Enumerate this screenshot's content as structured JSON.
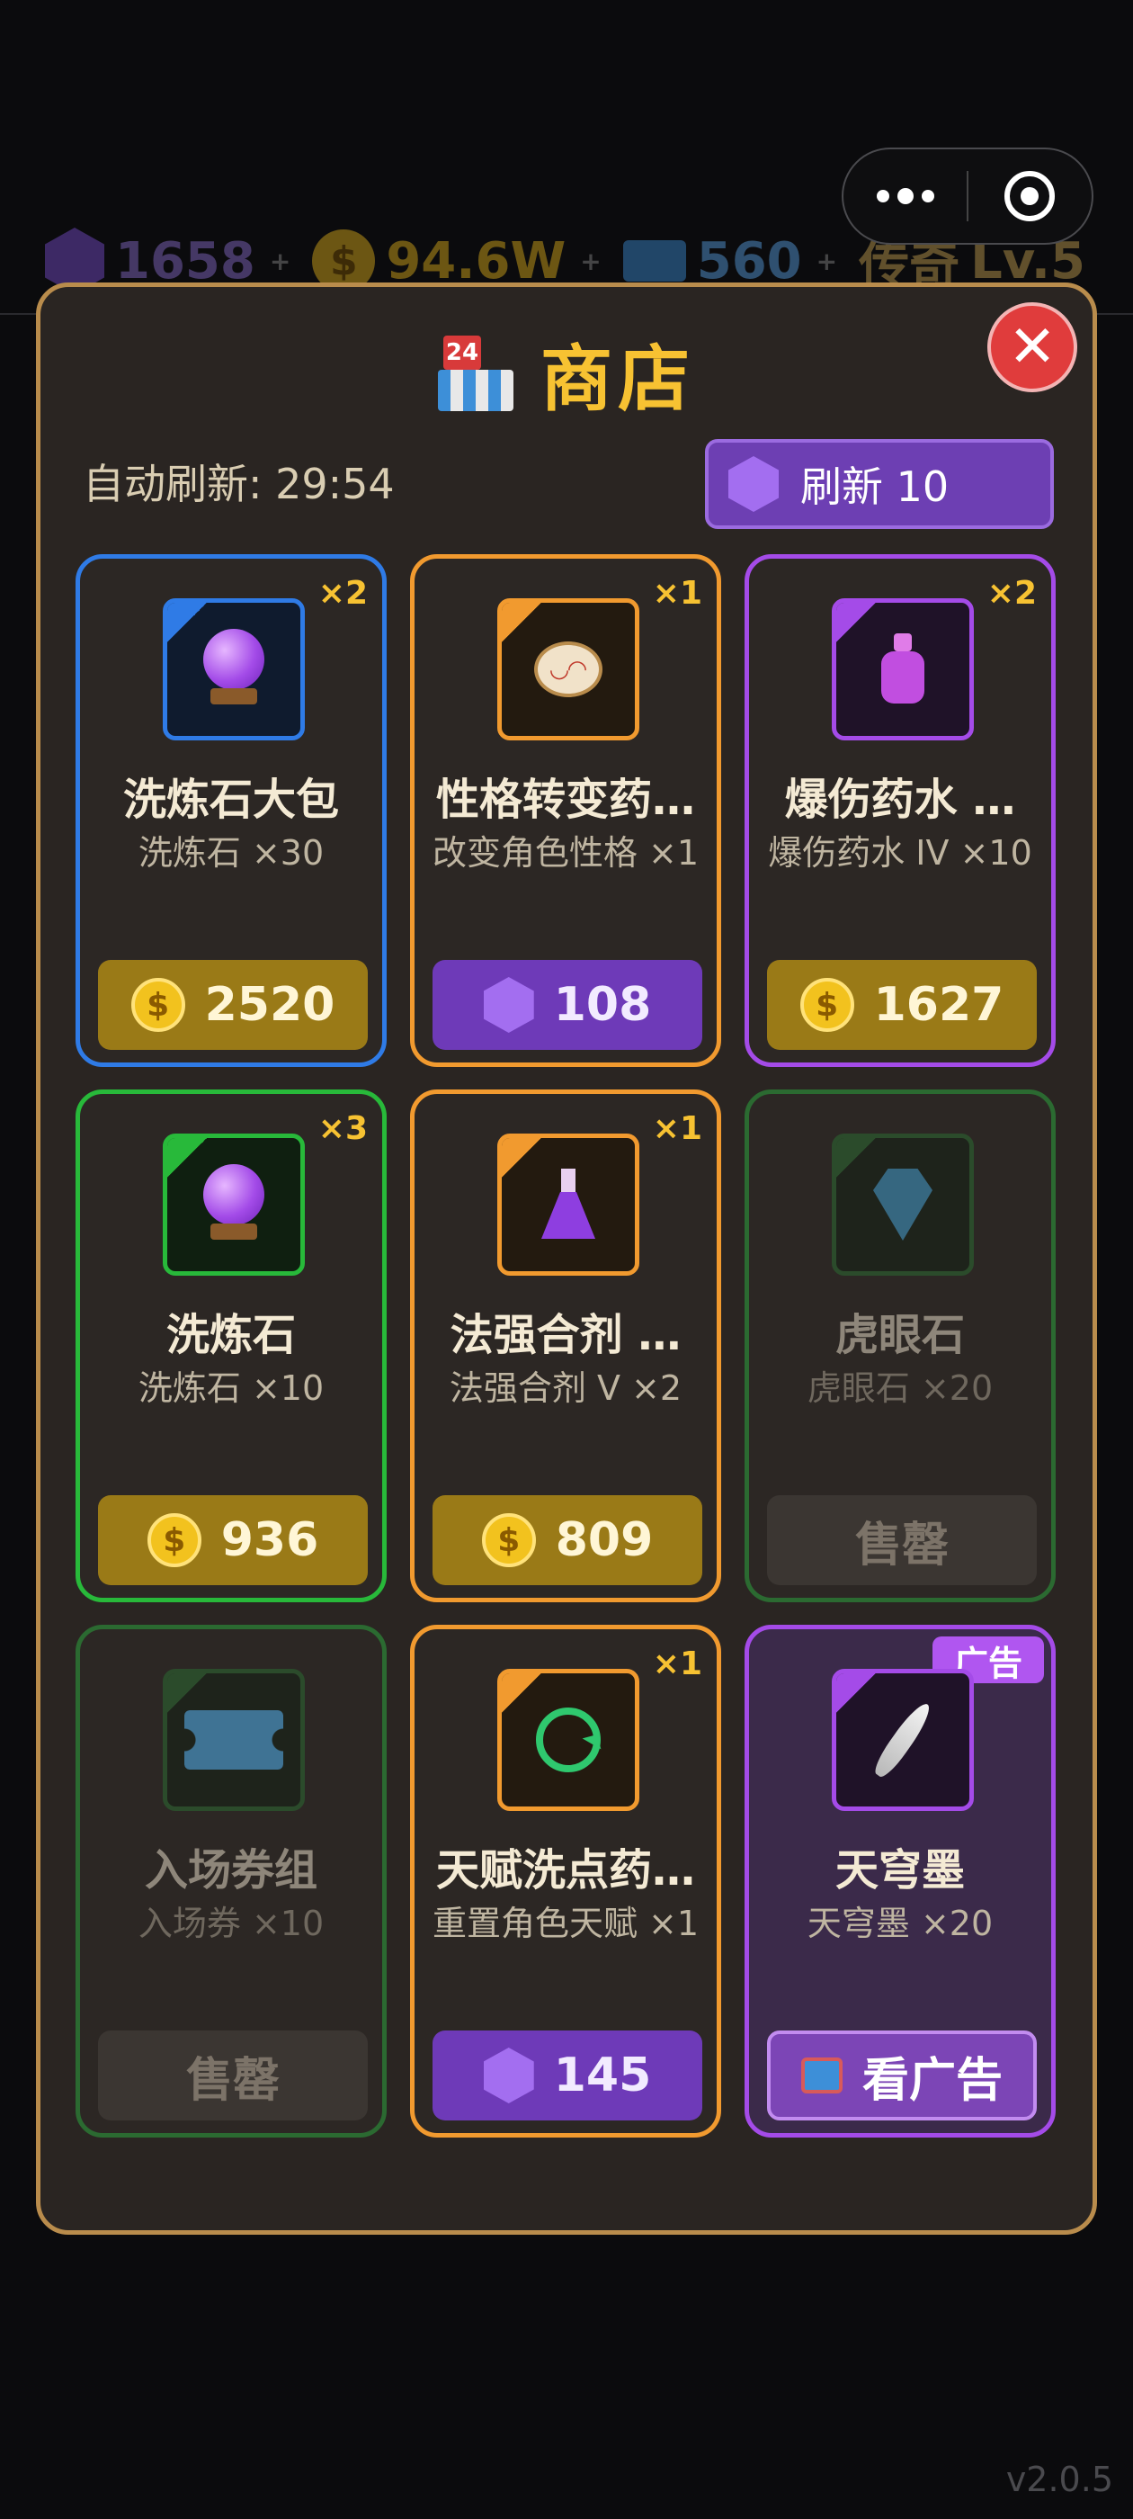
{
  "hud": {
    "gems": "1658",
    "coins": "94.6W",
    "tickets": "560",
    "rank": "传奇",
    "level": "Lv.5",
    "plus": "+"
  },
  "title": "商店",
  "calendar_badge": "24",
  "auto_refresh": "自动刷新: 29:54",
  "refresh_button": {
    "label": "刷新 10",
    "currency_icon": "gem-icon"
  },
  "items": [
    {
      "name": "洗炼石大包",
      "sub": "洗炼石 ×30",
      "qty": "×2",
      "price": "2520",
      "currency": "coin",
      "rarity": "blue",
      "icon": "crystal-orb-icon"
    },
    {
      "name": "性格转变药…",
      "sub": "改变角色性格 ×1",
      "qty": "×1",
      "price": "108",
      "currency": "gem",
      "rarity": "orange",
      "icon": "personality-pill-icon"
    },
    {
      "name": "爆伤药水 …",
      "sub": "爆伤药水 IV ×10",
      "qty": "×2",
      "price": "1627",
      "currency": "coin",
      "rarity": "purple",
      "icon": "potion-bottle-icon"
    },
    {
      "name": "洗炼石",
      "sub": "洗炼石 ×10",
      "qty": "×3",
      "price": "936",
      "currency": "coin",
      "rarity": "green",
      "icon": "crystal-orb-icon"
    },
    {
      "name": "法强合剂 …",
      "sub": "法强合剂 V ×2",
      "qty": "×1",
      "price": "809",
      "currency": "coin",
      "rarity": "orange",
      "icon": "flask-icon"
    },
    {
      "name": "虎眼石",
      "sub": "虎眼石 ×20",
      "qty": "",
      "price": "售罄",
      "currency": "sold",
      "rarity": "dkgreen",
      "icon": "gem-stone-icon"
    },
    {
      "name": "入场券组",
      "sub": "入场券 ×10",
      "qty": "",
      "price": "售罄",
      "currency": "sold",
      "rarity": "dkgreen",
      "icon": "ticket-icon"
    },
    {
      "name": "天赋洗点药…",
      "sub": "重置角色天赋 ×1",
      "qty": "×1",
      "price": "145",
      "currency": "gem",
      "rarity": "orange",
      "icon": "reset-cycle-icon"
    },
    {
      "name": "天穹墨",
      "sub": "天穹墨 ×20",
      "qty": "",
      "price": "看广告",
      "currency": "ad",
      "rarity": "ad",
      "icon": "feather-quill-icon",
      "tag": "广告"
    }
  ],
  "version": "v2.0.5",
  "colors": {
    "accent_gold": "#f7c232",
    "panel_border": "#b98c4c",
    "gem_purple": "#6e3ab8",
    "close_red": "#e03c3c"
  }
}
